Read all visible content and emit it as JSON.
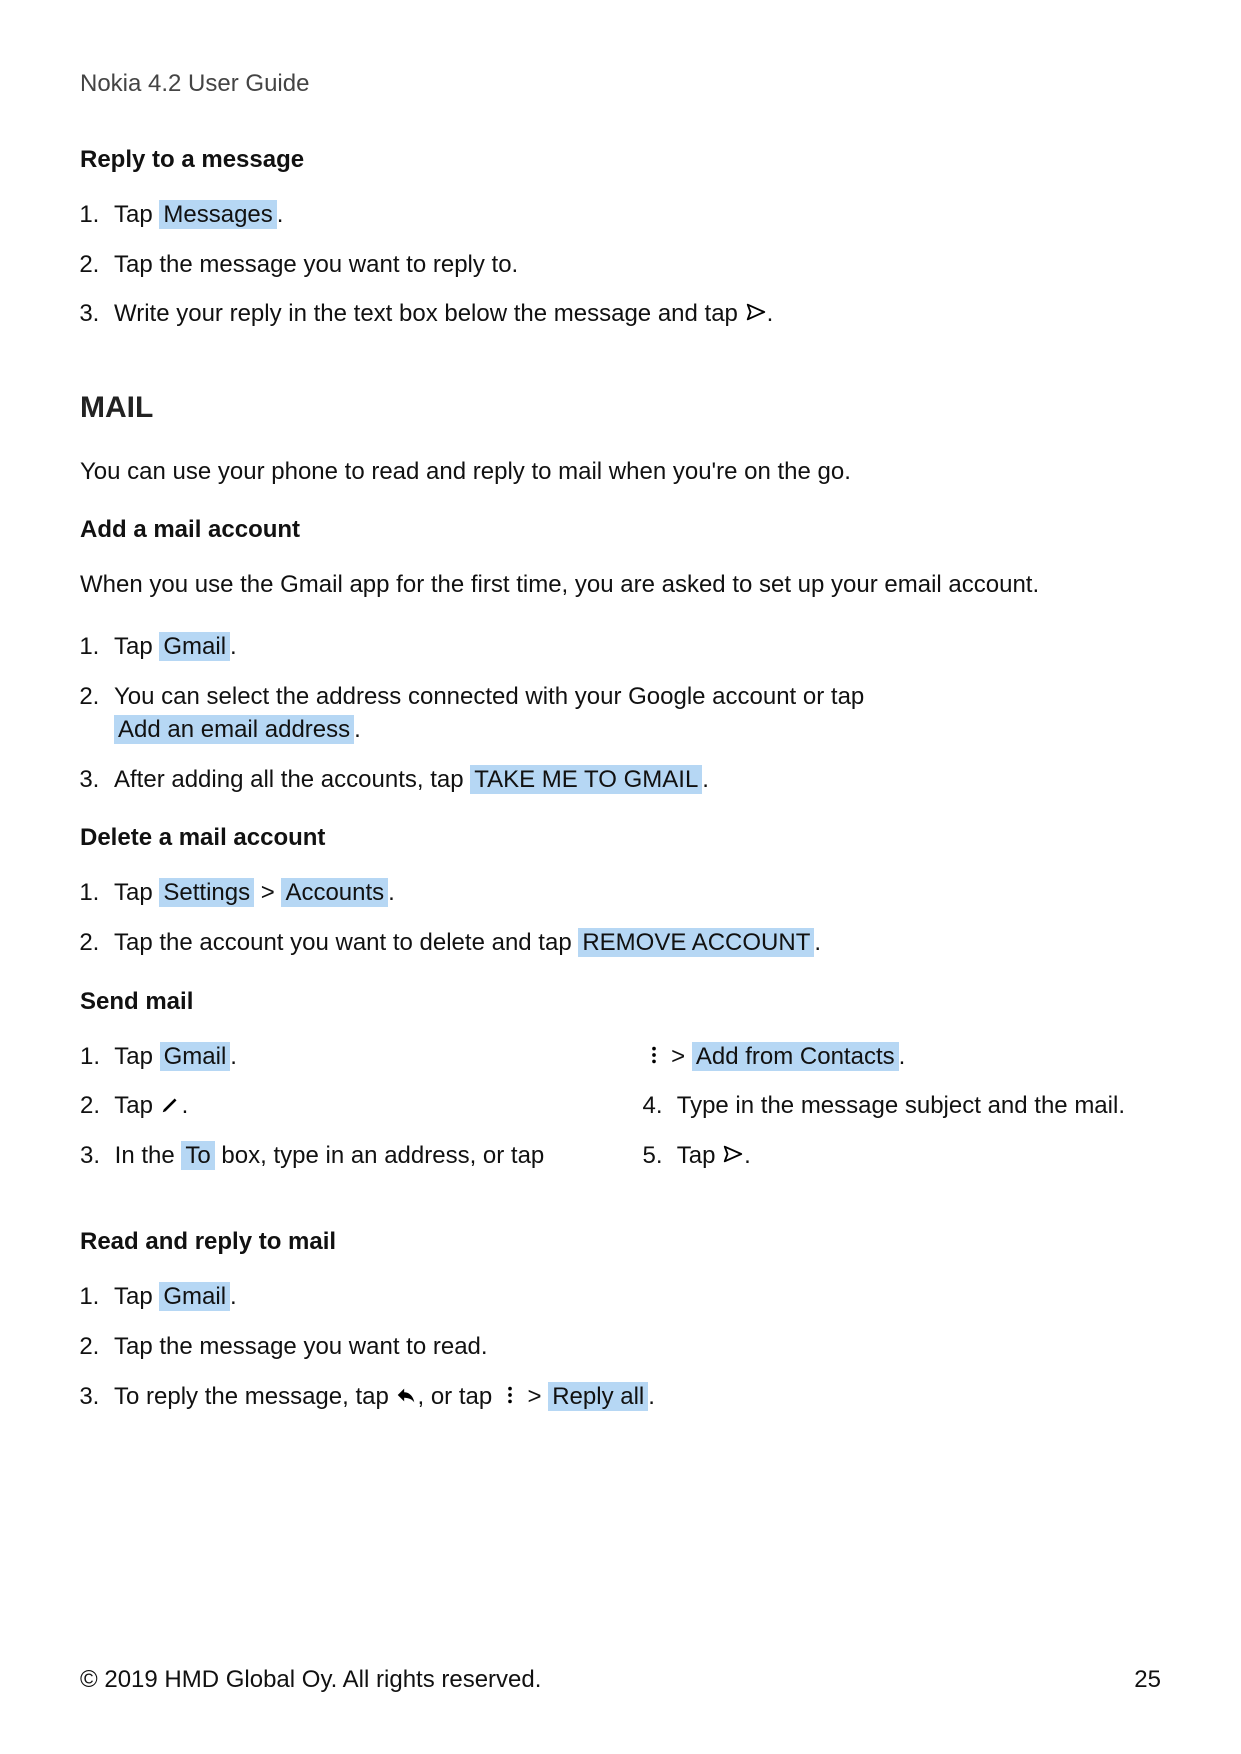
{
  "header": {
    "title": "Nokia 4.2 User Guide"
  },
  "sec_reply_msg": {
    "heading": "Reply to a message",
    "step1_pre": "Tap ",
    "step1_btn": "Messages",
    "step1_post": ".",
    "step2": "Tap the message you want to reply to.",
    "step3_pre": "Write your reply in the text box below the message and tap ",
    "step3_post": "."
  },
  "sec_mail": {
    "heading": "MAIL",
    "intro": "You can use your phone to read and reply to mail when you're on the go."
  },
  "sec_add_account": {
    "heading": "Add a mail account",
    "intro": "When you use the Gmail app for the first time, you are asked to set up your email account.",
    "step1_pre": "Tap ",
    "step1_btn": "Gmail",
    "step1_post": ".",
    "step2_pre": "You can select the address connected with your Google account or tap ",
    "step2_btn": "Add an email address",
    "step2_post": ".",
    "step3_pre": "After adding all the accounts, tap ",
    "step3_btn": "TAKE ME TO GMAIL",
    "step3_post": "."
  },
  "sec_del_account": {
    "heading": "Delete a mail account",
    "step1_pre": "Tap ",
    "step1_btn1": "Settings",
    "step1_mid": " > ",
    "step1_btn2": "Accounts",
    "step1_post": ".",
    "step2_pre": "Tap the account you want to delete and tap ",
    "step2_btn": "REMOVE ACCOUNT",
    "step2_post": "."
  },
  "sec_send_mail": {
    "heading": "Send mail",
    "s1_num": "1.",
    "s1_pre": "Tap ",
    "s1_btn": "Gmail",
    "s1_post": ".",
    "s2_num": "2.",
    "s2_pre": "Tap ",
    "s2_post": ".",
    "s3_num": "3.",
    "s3_pre": "In the ",
    "s3_btn": "To",
    "s3_mid": " box, type in an address, or tap",
    "s3b_mid": " > ",
    "s3b_btn": "Add from Contacts",
    "s3b_post": ".",
    "s4_num": "4.",
    "s4": "Type in the message subject and the mail.",
    "s5_num": "5.",
    "s5_pre": "Tap ",
    "s5_post": "."
  },
  "sec_read_reply": {
    "heading": "Read and reply to mail",
    "step1_pre": "Tap ",
    "step1_btn": "Gmail",
    "step1_post": ".",
    "step2": "Tap the message you want to read.",
    "step3_pre": "To reply the message, tap ",
    "step3_mid": ", or tap ",
    "step3_sep": " > ",
    "step3_btn": "Reply all",
    "step3_post": "."
  },
  "footer": {
    "copyright": "© 2019 HMD Global Oy. All rights reserved.",
    "page": "25"
  }
}
